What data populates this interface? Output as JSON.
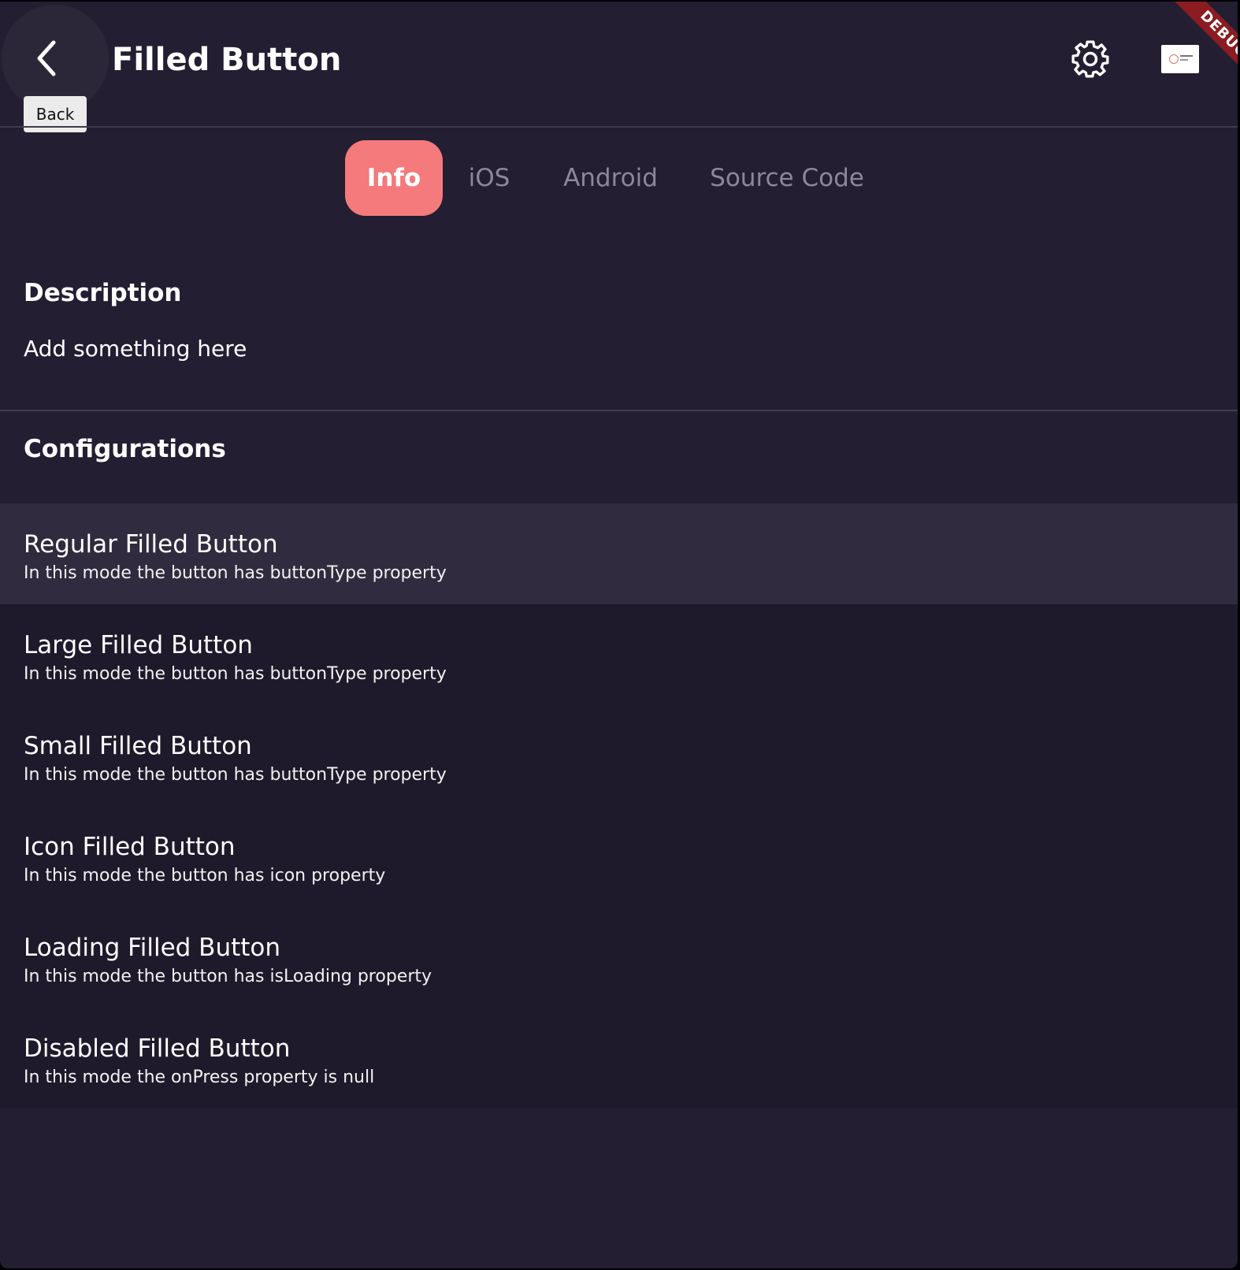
{
  "app_bar": {
    "back_tooltip": "Back",
    "title": "Filled Button",
    "debug_label": "DEBUG",
    "icons": {
      "back": "chevron-left-icon",
      "settings": "gear-icon",
      "logo": "app-logo"
    }
  },
  "tabs": [
    {
      "label": "Info",
      "active": true
    },
    {
      "label": "iOS",
      "active": false
    },
    {
      "label": "Android",
      "active": false
    },
    {
      "label": "Source Code",
      "active": false
    }
  ],
  "description": {
    "heading": "Description",
    "text": "Add something here"
  },
  "configurations": {
    "heading": "Configurations",
    "items": [
      {
        "title": "Regular Filled Button",
        "subtitle": "In this mode the button has buttonType property"
      },
      {
        "title": "Large Filled Button",
        "subtitle": "In this mode the button has buttonType property"
      },
      {
        "title": "Small Filled Button",
        "subtitle": "In this mode the button has buttonType property"
      },
      {
        "title": "Icon Filled Button",
        "subtitle": "In this mode the button has icon property"
      },
      {
        "title": "Loading Filled Button",
        "subtitle": "In this mode the button has isLoading property"
      },
      {
        "title": "Disabled Filled Button",
        "subtitle": "In this mode the onPress property is null"
      }
    ]
  },
  "colors": {
    "background": "#231e32",
    "tab_active": "#f47a7b",
    "tab_inactive_text": "#8c8898",
    "list_highlight": "#302b3e",
    "debug_banner": "#8b1d22"
  }
}
